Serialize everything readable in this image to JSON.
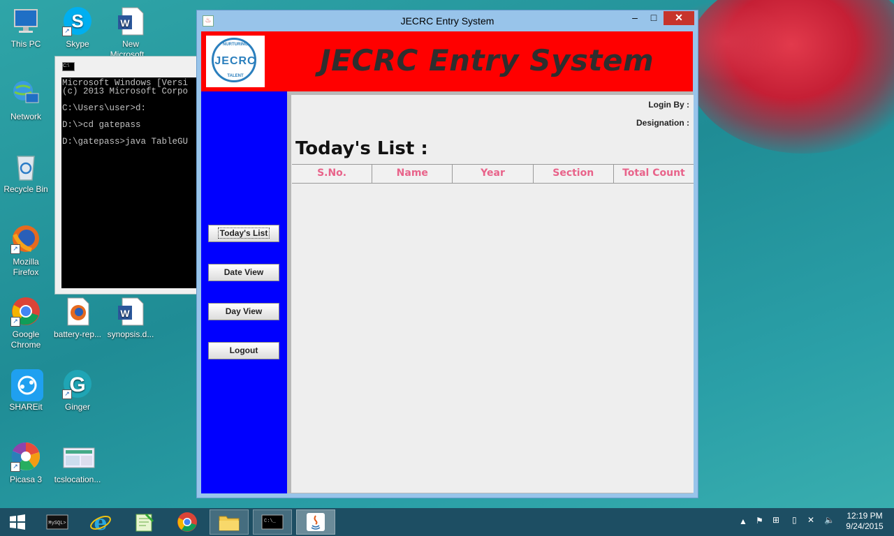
{
  "desktop": {
    "icons": [
      {
        "label": "This PC",
        "icon": "pc-icon"
      },
      {
        "label": "Skype",
        "icon": "skype-icon"
      },
      {
        "label": "New Microsoft...",
        "icon": "word-doc-icon"
      },
      {
        "label": "Network",
        "icon": "network-icon"
      },
      {
        "label": "Recycle Bin",
        "icon": "recycle-bin-icon"
      },
      {
        "label": "Mozilla Firefox",
        "icon": "firefox-icon"
      },
      {
        "label": "Google Chrome",
        "icon": "chrome-icon"
      },
      {
        "label": "battery-rep...",
        "icon": "firefox-file-icon"
      },
      {
        "label": "synopsis.d...",
        "icon": "word-doc-icon"
      },
      {
        "label": "SHAREit",
        "icon": "shareit-icon"
      },
      {
        "label": "Ginger",
        "icon": "ginger-icon"
      },
      {
        "label": "Picasa 3",
        "icon": "picasa-icon"
      },
      {
        "label": "tcslocation...",
        "icon": "image-file-icon"
      }
    ]
  },
  "cmd": {
    "lines": [
      "Microsoft Windows [Versi",
      "(c) 2013 Microsoft Corpo",
      "",
      "C:\\Users\\user>d:",
      "",
      "D:\\>cd gatepass",
      "",
      "D:\\gatepass>java TableGU"
    ]
  },
  "window": {
    "title": "JECRC Entry System",
    "header_title": "JECRC Entry System",
    "logo_text": "JECRC",
    "logo_top": "NURTURING",
    "logo_bottom": "TALENT"
  },
  "sidebar": {
    "buttons": [
      "Today's List",
      "Date View",
      "Day View",
      "Logout"
    ]
  },
  "main": {
    "login_by": "Login By :",
    "designation": "Designation :",
    "list_title": "Today's List :",
    "columns": [
      "S.No.",
      "Name",
      "Year",
      "Section",
      "Total Count"
    ]
  },
  "taskbar": {
    "apps": [
      "mysql-icon",
      "internet-explorer-icon",
      "notepad-plus-icon",
      "chrome-icon",
      "file-explorer-icon",
      "cmd-icon",
      "java-icon"
    ],
    "time": "12:19 PM",
    "date": "9/24/2015"
  }
}
